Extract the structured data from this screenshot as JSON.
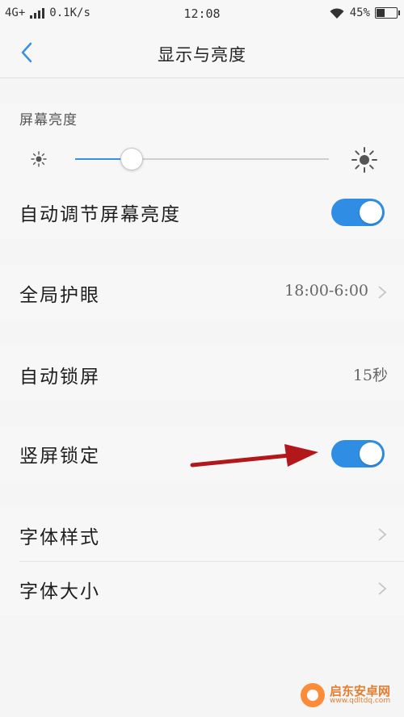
{
  "status_bar": {
    "network": "4G+",
    "speed": "0.1K/s",
    "time": "12:08",
    "battery": "45%",
    "battery_level": 0.45
  },
  "header": {
    "title": "显示与亮度",
    "back_icon": "chevron-left-icon"
  },
  "brightness": {
    "section_label": "屏幕亮度",
    "level": 0.22,
    "low_icon": "sun-small-icon",
    "high_icon": "sun-large-icon",
    "auto_label": "自动调节屏幕亮度",
    "auto_enabled": true
  },
  "settings": {
    "eye_protection": {
      "label": "全局护眼",
      "value": "18:00-6:00"
    },
    "auto_lock": {
      "label": "自动锁屏",
      "value": "15秒"
    },
    "portrait_lock": {
      "label": "竖屏锁定",
      "enabled": true
    },
    "font_style": {
      "label": "字体样式"
    },
    "font_size": {
      "label": "字体大小"
    }
  },
  "watermark": {
    "title": "启东安卓网",
    "url": "www.qdltdq.com"
  },
  "colors": {
    "accent": "#2f8de4",
    "arrow": "#b3161b",
    "background": "#f5f5f5"
  }
}
